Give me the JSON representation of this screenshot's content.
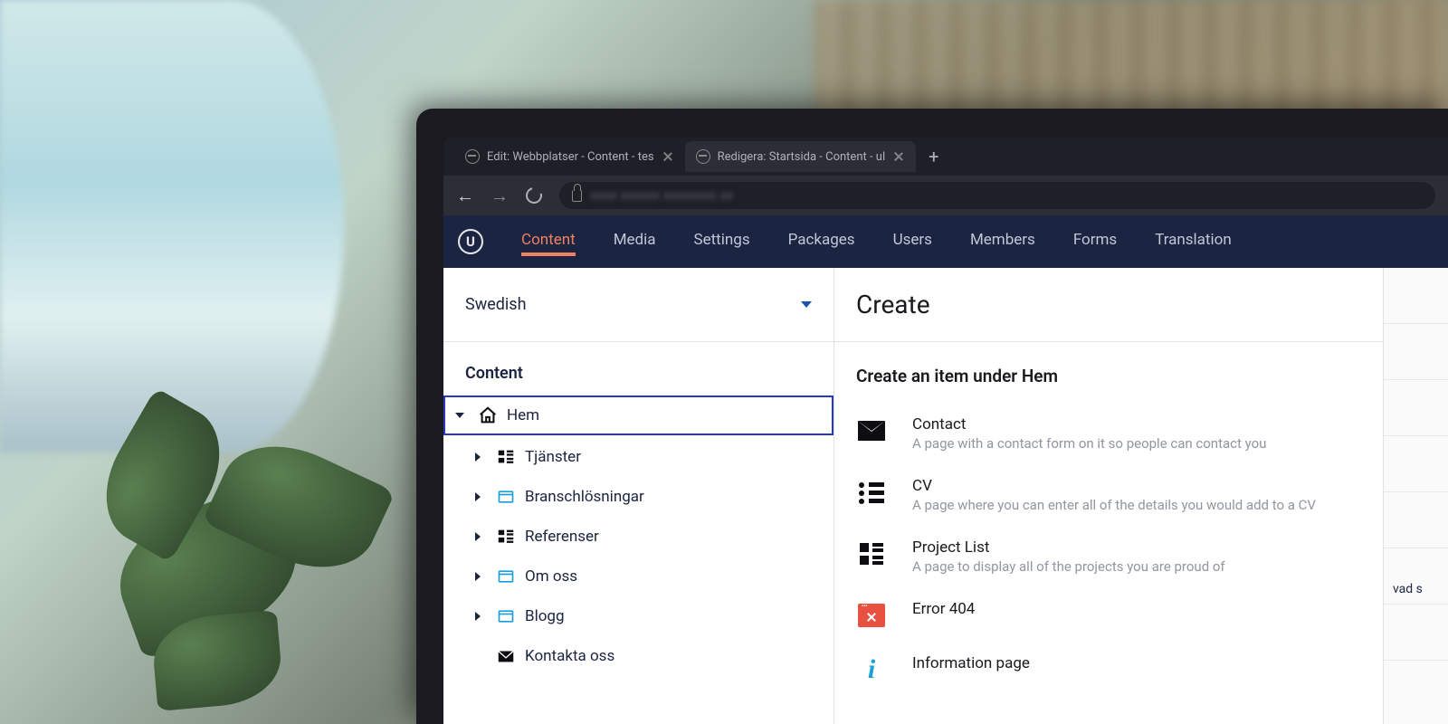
{
  "browser": {
    "tabs": [
      {
        "title": "Edit: Webbplatser - Content - tes",
        "active": false
      },
      {
        "title": "Redigera: Startsida - Content - ul",
        "active": true
      }
    ],
    "url_obscured": "xxxx xxxxxx xxxxxxxx xx"
  },
  "app_nav": {
    "logo_letter": "U",
    "items": [
      "Content",
      "Media",
      "Settings",
      "Packages",
      "Users",
      "Members",
      "Forms",
      "Translation"
    ],
    "active_index": 0
  },
  "left_panel": {
    "language": "Swedish",
    "heading": "Content",
    "tree": [
      {
        "label": "Hem",
        "icon": "home",
        "depth": 0,
        "expanded": true,
        "selected": true
      },
      {
        "label": "Tjänster",
        "icon": "grid",
        "depth": 1,
        "expanded": false
      },
      {
        "label": "Branschlösningar",
        "icon": "page",
        "depth": 1,
        "expanded": false
      },
      {
        "label": "Referenser",
        "icon": "grid",
        "depth": 1,
        "expanded": false
      },
      {
        "label": "Om oss",
        "icon": "page",
        "depth": 1,
        "expanded": false
      },
      {
        "label": "Blogg",
        "icon": "page",
        "depth": 1,
        "expanded": false
      },
      {
        "label": "Kontakta oss",
        "icon": "mail",
        "depth": 1,
        "expanded": null
      }
    ]
  },
  "main_panel": {
    "title": "Create",
    "sub_heading": "Create an item under Hem",
    "create_options": [
      {
        "title": "Contact",
        "desc": "A page with a contact form on it so people can contact you",
        "icon": "envelope"
      },
      {
        "title": "CV",
        "desc": "A page where you can enter all of the details you would add to a CV",
        "icon": "bullets"
      },
      {
        "title": "Project List",
        "desc": "A page to display all of the projects you are proud of",
        "icon": "grid4"
      },
      {
        "title": "Error 404",
        "desc": "",
        "icon": "error"
      },
      {
        "title": "Information page",
        "desc": "",
        "icon": "info"
      }
    ]
  },
  "right_sliver": {
    "visible_text": "vad s"
  }
}
